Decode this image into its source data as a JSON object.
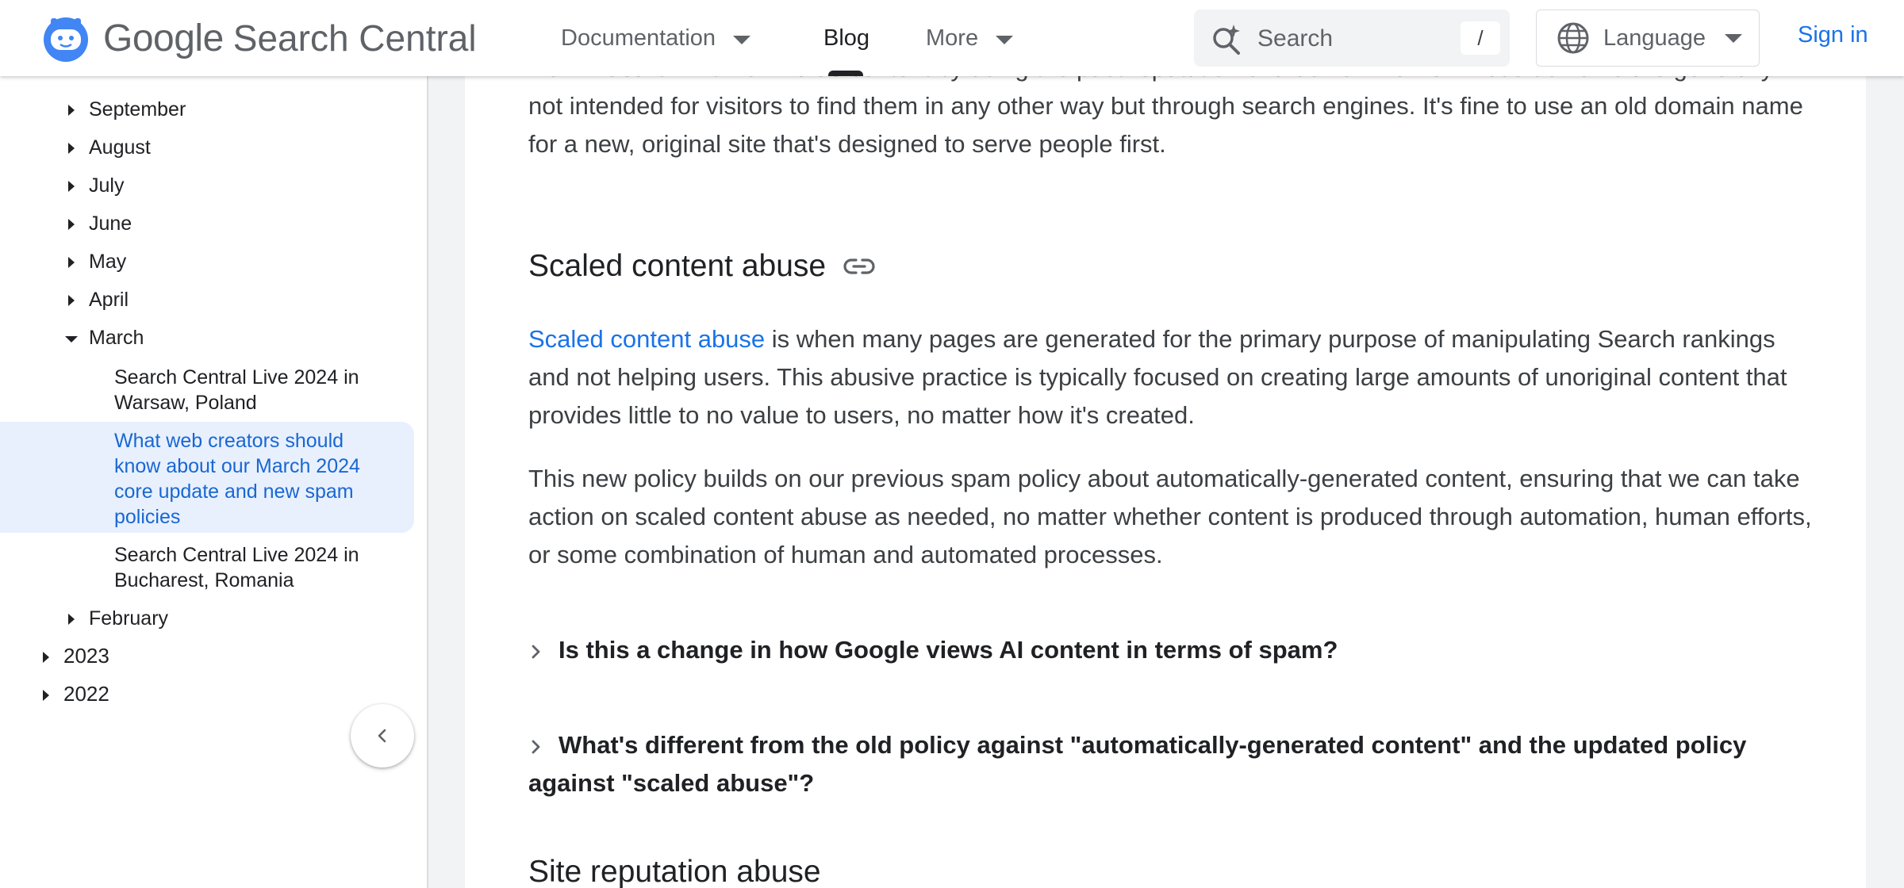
{
  "header": {
    "logo_google": "Google",
    "logo_sc": "Search Central",
    "nav": {
      "documentation": "Documentation",
      "blog": "Blog",
      "more": "More"
    },
    "search": {
      "placeholder": "Search",
      "shortcut": "/"
    },
    "language": "Language",
    "sign_in": "Sign in"
  },
  "sidebar": {
    "months": [
      "September",
      "August",
      "July",
      "June",
      "May",
      "April",
      "March",
      "February"
    ],
    "march_items": [
      "Search Central Live 2024 in Warsaw, Poland",
      "What web creators should know about our March 2024 core update and new spam policies",
      "Search Central Live 2024 in Bucharest, Romania"
    ],
    "years": [
      "2023",
      "2022"
    ]
  },
  "article": {
    "intro": "well in Search with low-value content by using the past reputation of a domain name. These domains are generally not intended for visitors to find them in any other way but through search engines. It's fine to use an old domain name for a new, original site that's designed to serve people first.",
    "section_scaled": "Scaled content abuse",
    "scaled_link": "Scaled content abuse",
    "scaled_p1_rest": " is when many pages are generated for the primary purpose of manipulating Search rankings and not helping users. This abusive practice is typically focused on creating large amounts of unoriginal content that provides little to no value to users, no matter how it's created.",
    "scaled_p2": "This new policy builds on our previous spam policy about automatically-generated content, ensuring that we can take action on scaled content abuse as needed, no matter whether content is produced through automation, human efforts, or some combination of human and automated processes.",
    "faq": [
      "Is this a change in how Google views AI content in terms of spam?",
      "What's different from the old policy against \"automatically-generated content\" and the updated policy against \"scaled abuse\"?"
    ],
    "section_site_rep": "Site reputation abuse"
  },
  "colors": {
    "link": "#1a73e8",
    "active_bg": "#e8f0fe",
    "active_text": "#1967d2",
    "logo_blue": "#4285f4"
  }
}
